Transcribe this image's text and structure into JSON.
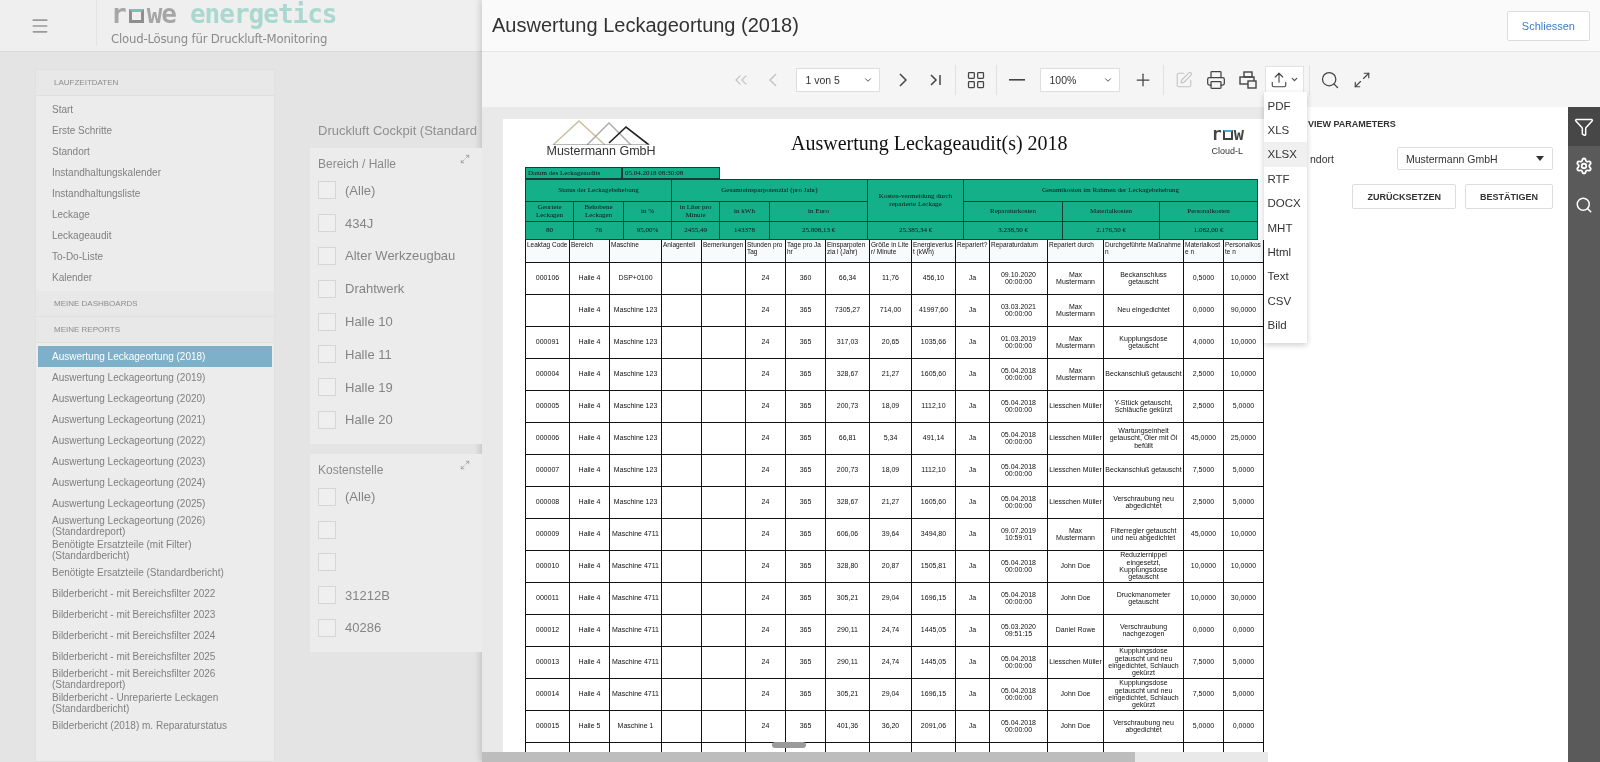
{
  "app": {
    "logo": {
      "part_1": "r",
      "part_2": "we",
      "part_3": "energetics",
      "tagline": "Cloud-Lösung für Druckluft-Monitoring"
    },
    "sidebar": {
      "sections": [
        {
          "title": "LAUFZEITDATEN",
          "items": [
            {
              "label": "Start",
              "selected": false
            },
            {
              "label": "Erste Schritte",
              "selected": false
            },
            {
              "label": "Standort",
              "selected": false
            },
            {
              "label": "Instandhaltungskalender",
              "selected": false
            },
            {
              "label": "Instandhaltungsliste",
              "selected": false
            },
            {
              "label": "Leckage",
              "selected": false
            },
            {
              "label": "Leckageaudit",
              "selected": false
            },
            {
              "label": "To-Do-Liste",
              "selected": false
            },
            {
              "label": "Kalender",
              "selected": false
            }
          ]
        },
        {
          "title": "MEINE DASHBOARDS"
        },
        {
          "title": "MEINE REPORTS",
          "items": [
            {
              "label": "Auswertung Leckageortung (2018)",
              "selected": true
            },
            {
              "label": "Auswertung Leckageortung (2019)",
              "selected": false
            },
            {
              "label": "Auswertung Leckageortung (2020)",
              "selected": false
            },
            {
              "label": "Auswertung Leckageortung (2021)",
              "selected": false
            },
            {
              "label": "Auswertung Leckageortung (2022)",
              "selected": false
            },
            {
              "label": "Auswertung Leckageortung (2023)",
              "selected": false
            },
            {
              "label": "Auswertung Leckageortung (2024)",
              "selected": false
            },
            {
              "label": "Auswertung Leckageortung (2025)",
              "selected": false
            },
            {
              "label": "Auswertung Leckageortung (2026) (Standardreport)",
              "selected": false
            },
            {
              "label": "Benötigte Ersatzteile (mit Filter) (Standardbericht)",
              "selected": false
            },
            {
              "label": "Benötigte Ersatzteile (Standardbericht)",
              "selected": false
            },
            {
              "label": "Bilderbericht - mit Bereichsfilter 2022",
              "selected": false
            },
            {
              "label": "Bilderbericht - mit Bereichsfilter 2023",
              "selected": false
            },
            {
              "label": "Bilderbericht - mit Bereichsfilter 2024",
              "selected": false
            },
            {
              "label": "Bilderbericht - mit Bereichsfilter 2025",
              "selected": false
            },
            {
              "label": "Bilderbericht - mit Bereichsfilter 2026 (Standardreport)",
              "selected": false
            },
            {
              "label": "Bilderbericht - Unreparierte Leckagen (Standardbericht)",
              "selected": false
            },
            {
              "label": "Bilderbericht (2018) m. Reparaturstatus",
              "selected": false
            }
          ]
        }
      ]
    },
    "dashboard_title": "Druckluft Cockpit (Standard",
    "filters": [
      {
        "title": "Bereich / Halle",
        "items": [
          {
            "label": "(Alle)",
            "checked": false
          },
          {
            "label": "434J",
            "checked": false
          },
          {
            "label": "Alter Werkzeugbau",
            "checked": false
          },
          {
            "label": "Drahtwerk",
            "checked": false
          },
          {
            "label": "Halle 10",
            "checked": false
          },
          {
            "label": "Halle 11",
            "checked": false
          },
          {
            "label": "Halle 19",
            "checked": false
          },
          {
            "label": "Halle 20",
            "checked": false
          }
        ]
      },
      {
        "title": "Kostenstelle",
        "items": [
          {
            "label": "(Alle)",
            "checked": false
          },
          {
            "checked": false
          },
          {
            "checked": false
          },
          {
            "label": "31212B",
            "checked": false
          },
          {
            "label": "40286",
            "checked": false
          }
        ]
      }
    ]
  },
  "viewer": {
    "title": "Auswertung Leckageortung (2018)",
    "close_button": "Schliessen",
    "toolbar": {
      "first_disabled": true,
      "prev_disabled": true,
      "page": "1 von 5",
      "zoom": "100%",
      "edit_disabled": true,
      "export_open": true
    },
    "export_menu": [
      {
        "label": "PDF",
        "selected": false
      },
      {
        "label": "XLS",
        "selected": false
      },
      {
        "label": "XLSX",
        "selected": true
      },
      {
        "label": "RTF",
        "selected": false
      },
      {
        "label": "DOCX",
        "selected": false
      },
      {
        "label": "MHT",
        "selected": false
      },
      {
        "label": "Html",
        "selected": false
      },
      {
        "label": "Text",
        "selected": false
      },
      {
        "label": "CSV",
        "selected": false
      },
      {
        "label": "Bild",
        "selected": false
      }
    ],
    "report": {
      "company": "Mustermann GmbH",
      "title": "Auswertung Leckageaudit(s) 2018",
      "brand_part_1": "r",
      "brand_part_2": "w",
      "brand_tagline": "Cloud-L",
      "date_label": "Datum des Leckageaudits",
      "date_value": "05.04.2018 08:30:08",
      "summary_groups": [
        {
          "label": "Status der Leckagebehebung",
          "columns": [
            {
              "label": "Geortete Leckagen",
              "value": "80"
            },
            {
              "label": "Behobene Leckagen",
              "value": "76"
            },
            {
              "label": "in %",
              "value": "95,00%"
            }
          ]
        },
        {
          "label": "Gesamteinsparpotenzial (pro Jahr)",
          "columns": [
            {
              "label": "in Liter pro Minute",
              "value": "2455,49"
            },
            {
              "label": "in kWh",
              "value": "143378"
            },
            {
              "label": "in Euro",
              "value": "25.808,13 €"
            }
          ]
        },
        {
          "label": "Kosten-vermeidung durch reparierte Leckage",
          "columns": [
            {
              "value": "25.385,34 €"
            }
          ]
        },
        {
          "label": "Gesamtkosten im Rahmen der Leckagebehebung",
          "columns": [
            {
              "label": "Reparaturkosten",
              "value": "3.238,50 €"
            },
            {
              "label": "Materialkosten",
              "value": "2.176,50 €"
            },
            {
              "label": "Personalkosten",
              "value": "1.062,00 €"
            }
          ]
        }
      ],
      "columns": [
        "Leaktag Code",
        "Bereich",
        "Maschine",
        "Anlagenteil",
        "Bemerkungen",
        "Stunden pro Tag",
        "Tage pro Jahr",
        "Einsparpotenzia l (Jahr)",
        "Größe in Liter/ Minute",
        "Energieverlust (kWh)",
        "Repariert?",
        "Reparaturdatum",
        "Repariert durch",
        "Durchgeführte Maßnahmen",
        "Materialkoste n",
        "Personalkoste n"
      ],
      "rows": [
        [
          "000106",
          "Halle 4",
          "DSP+0100",
          null,
          null,
          "24",
          "360",
          "66,34",
          "11,76",
          "456,10",
          "Ja",
          "09.10.2020 00:00:00",
          "Max Mustermann",
          "Beckanschluss getauscht",
          "0,5000",
          "10,0000"
        ],
        [
          null,
          "Halle 4",
          "Maschine 123",
          null,
          null,
          "24",
          "365",
          "7305,27",
          "714,00",
          "41997,60",
          "Ja",
          "03.03.2021 00:00:00",
          "Max Mustermann",
          "Neu eingedichtet",
          "0,0000",
          "90,0000"
        ],
        [
          "000091",
          "Halle 4",
          "Maschine 123",
          null,
          null,
          "24",
          "365",
          "317,03",
          "20,65",
          "1035,66",
          "Ja",
          "01.03.2019 00:00:00",
          "Max Mustermann",
          "Kupplungsdose getauscht",
          "4,0000",
          "10,0000"
        ],
        [
          "000004",
          "Halle 4",
          "Maschine 123",
          null,
          null,
          "24",
          "365",
          "328,67",
          "21,27",
          "1605,60",
          "Ja",
          "05.04.2018 00:00:00",
          "Max Mustermann",
          "Beckanschluß getauscht",
          "2,5000",
          "10,0000"
        ],
        [
          "000005",
          "Halle 4",
          "Maschine 123",
          null,
          null,
          "24",
          "365",
          "200,73",
          "18,09",
          "1112,10",
          "Ja",
          "05.04.2018 00:00:00",
          "Liesschen Müller",
          "Y-Stück getauscht, Schläuche gekürzt",
          "2,5000",
          "5,0000"
        ],
        [
          "000006",
          "Halle 4",
          "Maschine 123",
          null,
          null,
          "24",
          "365",
          "66,81",
          "5,34",
          "491,14",
          "Ja",
          "05.04.2018 00:00:00",
          "Liesschen Müller",
          "Wartungseinheit getauscht, Öler mit Öl befüllt",
          "45,0000",
          "25,0000"
        ],
        [
          "000007",
          "Halle 4",
          "Maschine 123",
          null,
          null,
          "24",
          "365",
          "200,73",
          "18,09",
          "1112,10",
          "Ja",
          "05.04.2018 00:00:00",
          "Liesschen Müller",
          "Beckanschluß getauscht",
          "7,5000",
          "5,0000"
        ],
        [
          "000008",
          "Halle 4",
          "Maschine 123",
          null,
          null,
          "24",
          "365",
          "328,67",
          "21,27",
          "1605,60",
          "Ja",
          "05.04.2018 00:00:00",
          "Liesschen Müller",
          "Verschraubung neu abgedichtet",
          "2,5000",
          "5,0000"
        ],
        [
          "000009",
          "Halle 4",
          "Maschine 4711",
          null,
          null,
          "24",
          "365",
          "606,06",
          "39,64",
          "3494,80",
          "Ja",
          "09.07.2019 10:59:01",
          "Max Mustermann",
          "Filterregler getauscht und neu abgedichtet",
          "45,0000",
          "10,0000"
        ],
        [
          "000010",
          "Halle 4",
          "Maschine 4711",
          null,
          null,
          "24",
          "365",
          "328,80",
          "20,87",
          "1505,81",
          "Ja",
          "05.04.2018 00:00:00",
          "John Doe",
          "Reduziernippel eingesetzt, Kupplungsdose getauscht",
          "10,0000",
          "10,0000"
        ],
        [
          "000011",
          "Halle 4",
          "Maschine 4711",
          null,
          null,
          "24",
          "365",
          "305,21",
          "29,04",
          "1696,15",
          "Ja",
          "05.04.2018 00:00:00",
          "John Doe",
          "Druckmanometer getauscht",
          "10,0000",
          "30,0000"
        ],
        [
          "000012",
          "Halle 4",
          "Maschine 4711",
          null,
          null,
          "24",
          "365",
          "290,11",
          "24,74",
          "1445,05",
          "Ja",
          "05.03.2020 09:51:15",
          "Daniel Rowe",
          "Verschraubung nachgezogen",
          "0,0000",
          "0,0000"
        ],
        [
          "000013",
          "Halle 4",
          "Maschine 4711",
          null,
          null,
          "24",
          "365",
          "290,11",
          "24,74",
          "1445,05",
          "Ja",
          "05.04.2018 00:00:00",
          "Liesschen Müller",
          "Kupplungsdose getauscht und neu eingedichtet, Schlauch gekürzt",
          "7,5000",
          "5,0000"
        ],
        [
          "000014",
          "Halle 4",
          "Maschine 4711",
          null,
          null,
          "24",
          "365",
          "305,21",
          "29,04",
          "1696,15",
          "Ja",
          "05.04.2018 00:00:00",
          "John Doe",
          "Kupplungsdose getauscht und neu eingedichtet, Schlauch gekürzt",
          "7,5000",
          "5,0000"
        ],
        [
          "000015",
          "Halle 5",
          "Maschine 1",
          null,
          null,
          "24",
          "365",
          "401,36",
          "36,20",
          "2091,06",
          "Ja",
          "05.04.2018 00:00:00",
          "John Doe",
          "Verschraubung neu abgedichtet",
          "5,0000",
          "0,0000"
        ]
      ]
    },
    "parameters": {
      "title": "VIEW PARAMETERS",
      "field_label": "ndort",
      "field_value": "Mustermann GmbH",
      "buttons": [
        "ZURÜCKSETZEN",
        "BESTÄTIGEN"
      ]
    },
    "side_tabs": [
      {
        "selected": true
      },
      {
        "selected": false
      },
      {
        "selected": false
      }
    ]
  }
}
